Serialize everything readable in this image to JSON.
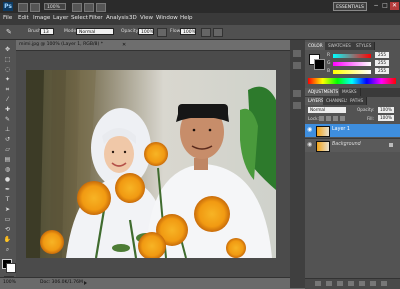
{
  "app": {
    "logo": "Ps",
    "workspace": "ESSENTIALS",
    "window_buttons": [
      "−",
      "□",
      "✕"
    ]
  },
  "menus": [
    "File",
    "Edit",
    "Image",
    "Layer",
    "Select",
    "Filter",
    "Analysis",
    "3D",
    "View",
    "Window",
    "Help"
  ],
  "options": {
    "brush_label": "Brush:",
    "brush_size": "13",
    "mode_label": "Mode:",
    "mode_value": "Normal",
    "opacity_label": "Opacity:",
    "opacity_value": "100%",
    "flow_label": "Flow:",
    "flow_value": "100%"
  },
  "document": {
    "title": "mimi.jpg @ 100% (Layer 1, RGB/8) *",
    "zoom": "100%",
    "doc_info": "Doc: 306.0K/1.76M"
  },
  "color_panel": {
    "tabs": [
      "COLOR",
      "SWATCHES",
      "STYLES"
    ],
    "channels": [
      {
        "label": "R",
        "value": "255"
      },
      {
        "label": "G",
        "value": "255"
      },
      {
        "label": "B",
        "value": "255"
      }
    ]
  },
  "adjust_tabs": [
    "ADJUSTMENTS",
    "MASKS"
  ],
  "layers_panel": {
    "tabs": [
      "LAYERS",
      "CHANNELS",
      "PATHS"
    ],
    "blend_mode": "Normal",
    "opacity_label": "Opacity:",
    "opacity_value": "100%",
    "lock_label": "Lock:",
    "fill_label": "Fill:",
    "fill_value": "100%",
    "layers": [
      {
        "name": "Layer 1",
        "selected": true
      },
      {
        "name": "Background",
        "selected": false
      }
    ]
  },
  "colors": {
    "accent": "#3a7fc1",
    "selection": "#3e8ede",
    "appbar": "#2b2b2b"
  }
}
